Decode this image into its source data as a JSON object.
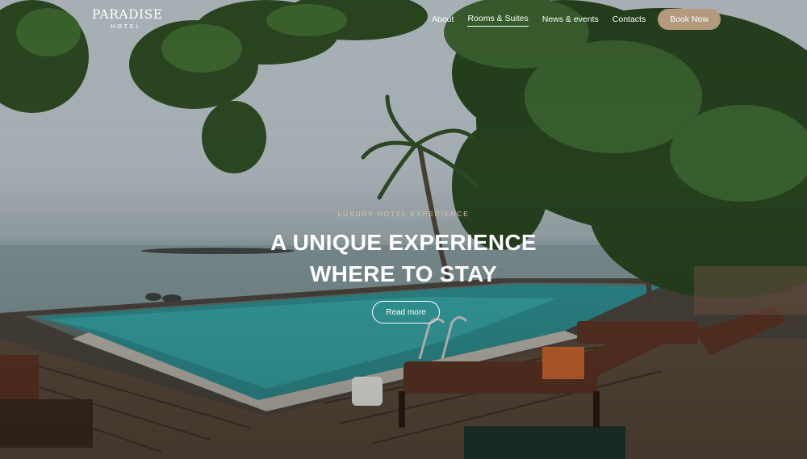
{
  "brand": {
    "name": "PARADISE",
    "subtitle": "HOTEL"
  },
  "nav": {
    "items": [
      {
        "label": "About",
        "active": false
      },
      {
        "label": "Rooms & Suites",
        "active": true
      },
      {
        "label": "News & events",
        "active": false
      },
      {
        "label": "Contacts",
        "active": false
      }
    ],
    "cta_label": "Book Now"
  },
  "hero": {
    "kicker": "LUXURY HOTEL EXPERIENCE",
    "headline_line1": "A UNIQUE EXPERIENCE",
    "headline_line2": "WHERE TO STAY",
    "button_label": "Read more"
  },
  "colors": {
    "accent": "#b39a7c",
    "kicker": "#d9c6a8",
    "text": "#ffffff"
  }
}
